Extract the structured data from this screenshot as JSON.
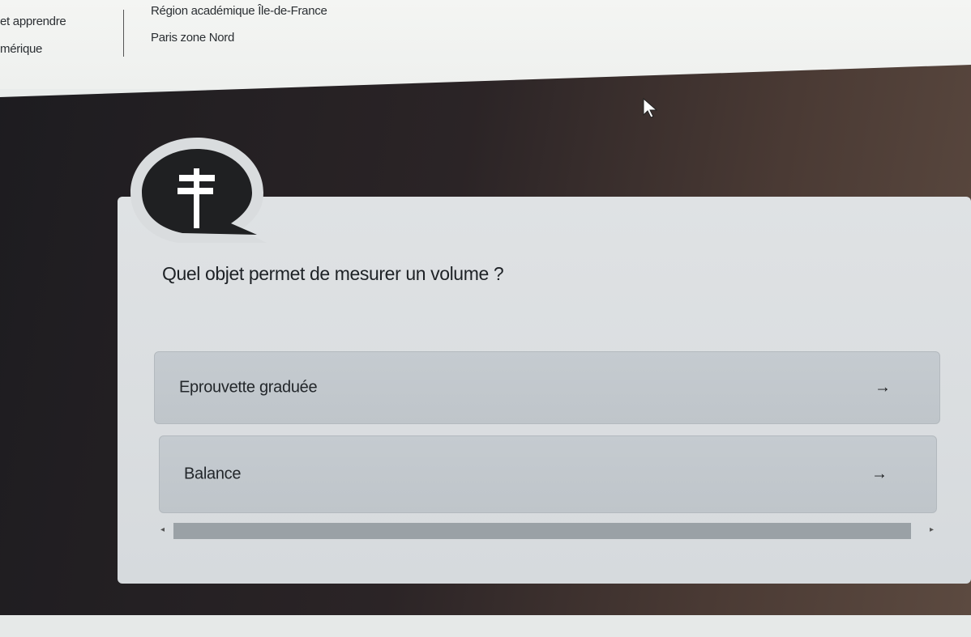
{
  "header": {
    "left_line1": "et apprendre",
    "left_line2": "mérique",
    "region": "Région académique Île-de-France",
    "place": "Paris zone Nord"
  },
  "quiz": {
    "badge_icon": "signpost-icon",
    "question": "Quel objet permet de mesurer un volume ?",
    "answers": [
      {
        "label": "Eprouvette graduée",
        "arrow": "→"
      },
      {
        "label": "Balance",
        "arrow": "→"
      }
    ],
    "scroll_left": "◂",
    "scroll_right": "▸"
  },
  "colors": {
    "hero_dark": "#1d1c20",
    "card": "#dfe2e4",
    "answer": "#c5cbd0",
    "badge": "#1f2022"
  }
}
